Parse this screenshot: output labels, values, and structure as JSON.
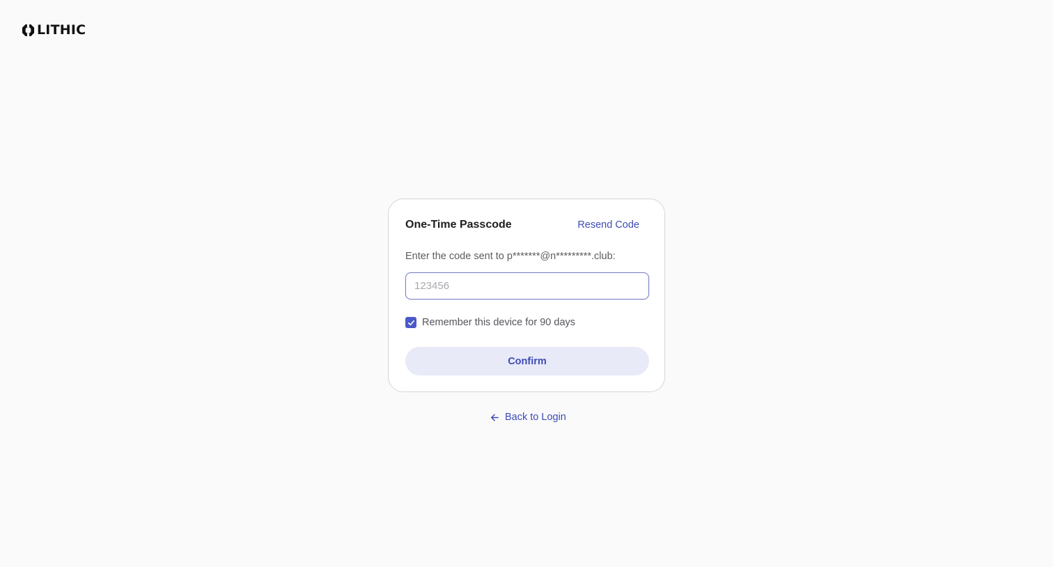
{
  "brand": {
    "name": "LITHIC",
    "logo_icon": "lithic-logo-icon"
  },
  "otp_card": {
    "title": "One-Time Passcode",
    "resend_label": "Resend Code",
    "prompt": "Enter the code sent to p*******@n*********.club:",
    "code_input": {
      "value": "",
      "placeholder": "123456"
    },
    "remember_device": {
      "label": "Remember this device for 90 days",
      "checked": true,
      "icon": "check-icon"
    },
    "confirm_label": "Confirm"
  },
  "back_link": {
    "label": "Back to Login",
    "icon": "arrow-left-icon"
  },
  "colors": {
    "accent": "#3d4bb5",
    "checkbox": "#4c59c9",
    "button_bg": "#e8eaf8",
    "page_bg": "#fafafa"
  }
}
